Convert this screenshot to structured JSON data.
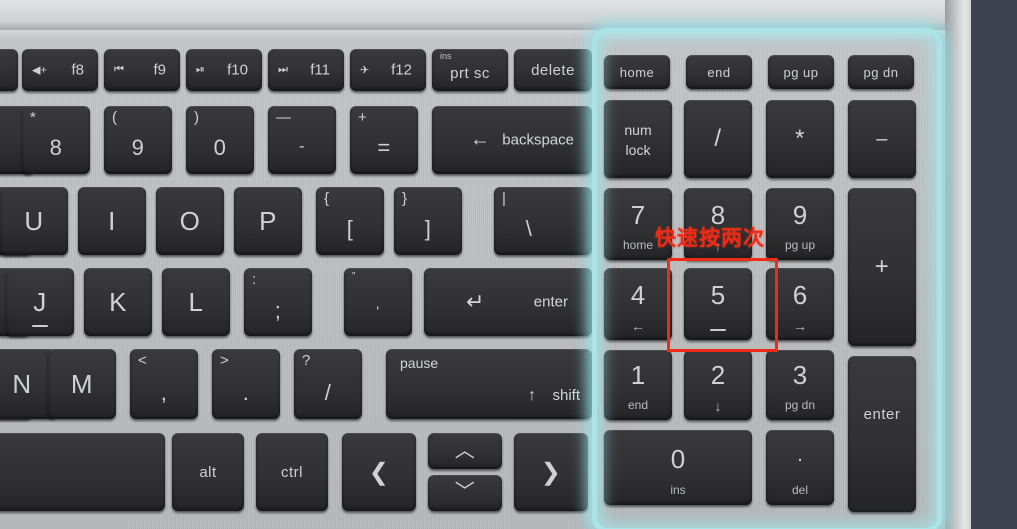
{
  "scene": {
    "description": "Laptop keyboard close-up with numeric keypad highlighted",
    "highlight_color": "#a9e4e8",
    "annotation_color": "#ee2b16",
    "panel_color": "#3c434f",
    "key_color": "#313133",
    "deck_color": "#bdbfc1"
  },
  "annotation": {
    "text": "快速按两次",
    "target_key": "5"
  },
  "function_row": [
    {
      "label": "f8",
      "icon": "volume-up-icon",
      "glyph": "◀+"
    },
    {
      "label": "f9",
      "icon": "prev-track-icon",
      "glyph": "⏮"
    },
    {
      "label": "f10",
      "icon": "play-pause-icon",
      "glyph": "⏯"
    },
    {
      "label": "f11",
      "icon": "next-track-icon",
      "glyph": "⏭"
    },
    {
      "label": "f12",
      "icon": "airplane-mode-icon",
      "glyph": "✈"
    }
  ],
  "function_row_extra": [
    {
      "label": "prt sc",
      "sup": "ins"
    },
    {
      "label": "delete",
      "sup": ""
    }
  ],
  "number_row": [
    {
      "main": "8",
      "shift": "*"
    },
    {
      "main": "9",
      "shift": "("
    },
    {
      "main": "0",
      "shift": ")"
    },
    {
      "main": "-",
      "shift": "—"
    },
    {
      "main": "=",
      "shift": "+"
    }
  ],
  "backspace": {
    "label": "backspace",
    "icon": "backspace-arrow-icon",
    "glyph": "←"
  },
  "letter_row_upper": [
    "U",
    "I",
    "O",
    "P"
  ],
  "bracket_keys": [
    {
      "main": "[",
      "shift": "{"
    },
    {
      "main": "]",
      "shift": "}"
    },
    {
      "main": "\\",
      "shift": "|"
    }
  ],
  "home_row": [
    "J",
    "K",
    "L"
  ],
  "home_row_punct": [
    {
      "main": ";",
      "shift": ":"
    },
    {
      "main": "'",
      "shift": "\""
    }
  ],
  "enter_key": {
    "label": "enter",
    "icon": "return-arrow-icon",
    "glyph": "↵"
  },
  "bottom_letter_row": [
    "N",
    "M"
  ],
  "bottom_punct": [
    {
      "main": ",",
      "shift": "<"
    },
    {
      "main": ".",
      "shift": ">"
    },
    {
      "main": "/",
      "shift": "?"
    }
  ],
  "shift_key": {
    "label": "shift",
    "top_label": "pause",
    "glyph": "↑"
  },
  "modifier_row": [
    {
      "label": "",
      "name": "spacebar"
    },
    {
      "label": "alt",
      "name": "alt-key"
    },
    {
      "label": "ctrl",
      "name": "ctrl-key"
    }
  ],
  "arrow_keys": [
    {
      "name": "arrow-left",
      "glyph": "❮"
    },
    {
      "name": "arrow-up",
      "glyph": "︿"
    },
    {
      "name": "arrow-down",
      "glyph": "﹀"
    },
    {
      "name": "arrow-right",
      "glyph": "❯"
    }
  ],
  "numpad": {
    "nav_row": [
      "home",
      "end",
      "pg up",
      "pg dn"
    ],
    "row1": [
      {
        "main": "num",
        "main2": "lock",
        "sub": ""
      },
      {
        "main": "/",
        "sub": ""
      },
      {
        "main": "*",
        "sub": ""
      },
      {
        "main": "–",
        "sub": ""
      }
    ],
    "row2": [
      {
        "main": "7",
        "sub": "home"
      },
      {
        "main": "8",
        "sub": "↑"
      },
      {
        "main": "9",
        "sub": "pg up"
      }
    ],
    "row3": [
      {
        "main": "4",
        "sub": "←"
      },
      {
        "main": "5",
        "sub": ""
      },
      {
        "main": "6",
        "sub": "→"
      }
    ],
    "row4": [
      {
        "main": "1",
        "sub": "end"
      },
      {
        "main": "2",
        "sub": "↓"
      },
      {
        "main": "3",
        "sub": "pg dn"
      }
    ],
    "row5": [
      {
        "main": "0",
        "sub": "ins"
      },
      {
        "main": ".",
        "sub": "del"
      }
    ],
    "plus_key": "+",
    "enter_key": "enter"
  }
}
